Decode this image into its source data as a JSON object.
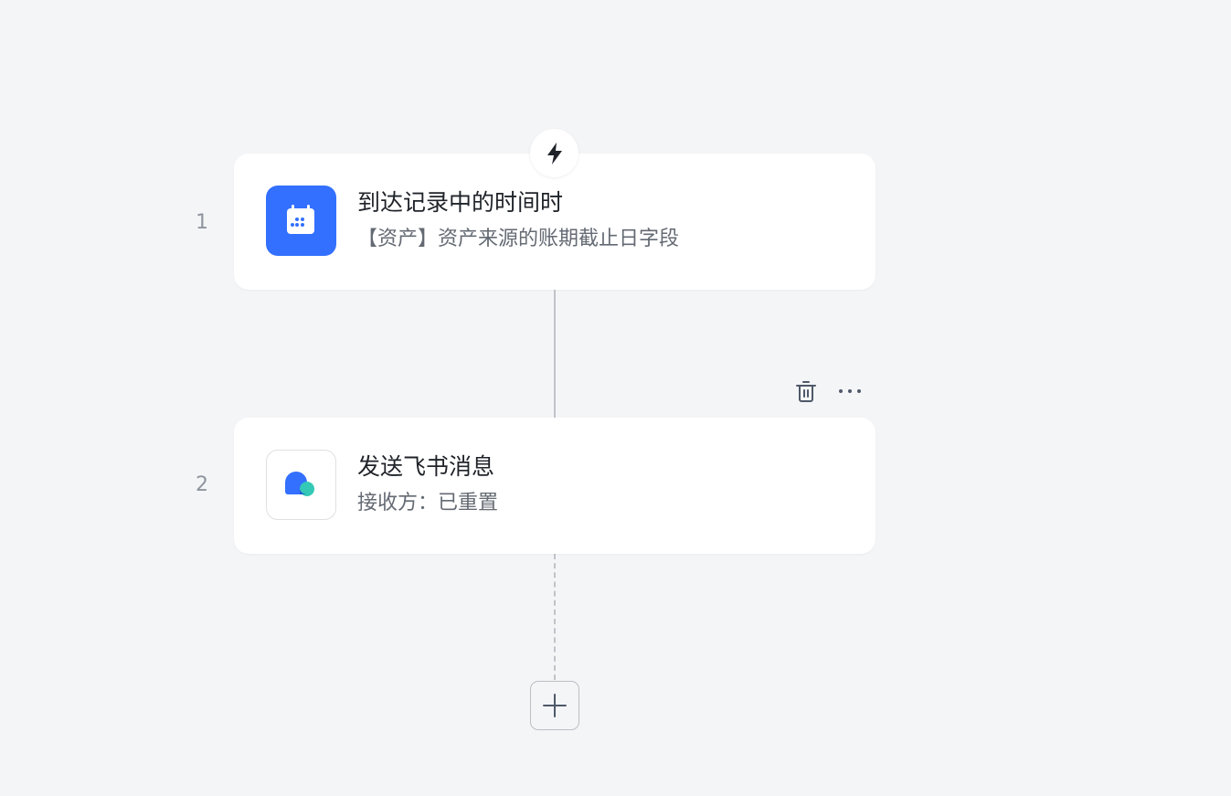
{
  "steps": [
    {
      "number": "1",
      "title": "到达记录中的时间时",
      "subtitle": "【资产】资产来源的账期截止日字段",
      "icon": "calendar-icon"
    },
    {
      "number": "2",
      "title": "发送飞书消息",
      "subtitle": "接收方：已重置",
      "icon": "feishu-message-icon"
    }
  ],
  "trigger_icon": "lightning-icon",
  "step_actions": {
    "delete_icon": "trash-icon",
    "more_icon": "more-horizontal-icon"
  },
  "add_step_icon": "plus-icon",
  "colors": {
    "background": "#f4f5f7",
    "accent_blue": "#3370ff",
    "message_teal": "#34c9b6",
    "title_text": "#1f2329",
    "subtitle_text": "#646a73"
  }
}
